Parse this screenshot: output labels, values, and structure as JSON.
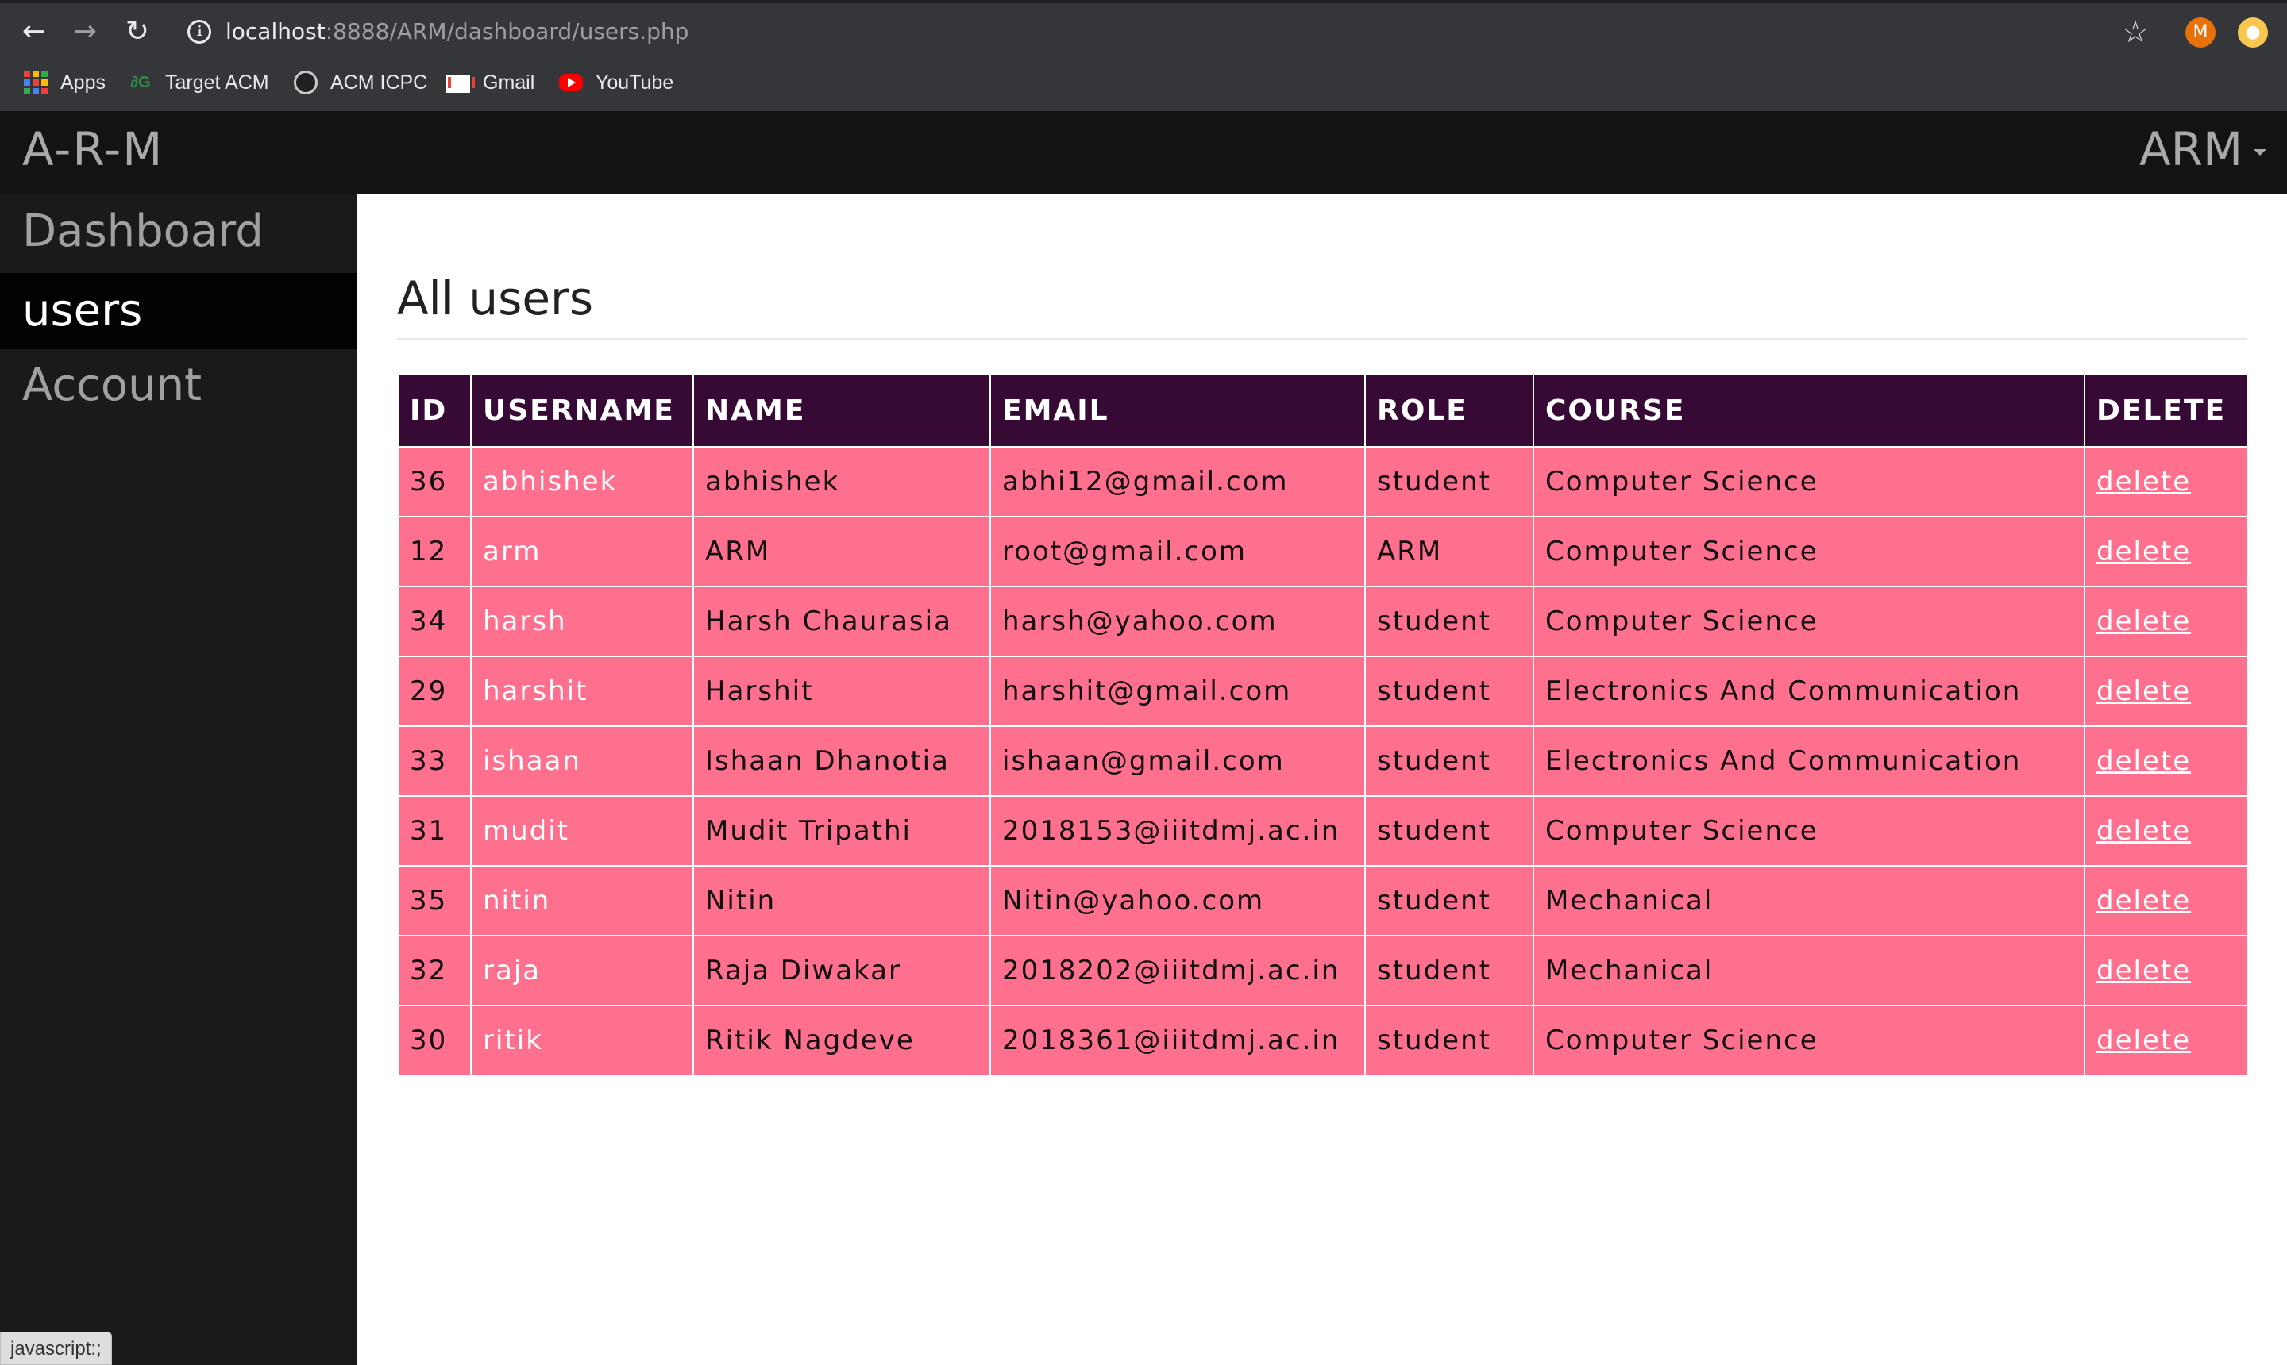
{
  "browser": {
    "url_host": "localhost",
    "url_rest": ":8888/ARM/dashboard/users.php",
    "avatar_letter": "M",
    "bookmarks": [
      {
        "label": "Apps",
        "icon": "apps-grid-icon"
      },
      {
        "label": "Target ACM",
        "icon": "geeksforgeeks-icon"
      },
      {
        "label": "ACM ICPC",
        "icon": "github-icon"
      },
      {
        "label": "Gmail",
        "icon": "gmail-icon"
      },
      {
        "label": "YouTube",
        "icon": "youtube-icon"
      }
    ]
  },
  "header": {
    "brand": "A-R-M",
    "user_menu": "ARM"
  },
  "sidebar": {
    "items": [
      {
        "label": "Dashboard",
        "active": false
      },
      {
        "label": "users",
        "active": true
      },
      {
        "label": "Account",
        "active": false
      }
    ]
  },
  "status_bar": "javascript:;",
  "main": {
    "title": "All users",
    "table": {
      "columns": [
        "ID",
        "USERNAME",
        "NAME",
        "EMAIL",
        "ROLE",
        "COURSE",
        "DELETE"
      ],
      "rows": [
        {
          "id": "36",
          "username": "abhishek",
          "name": "abhishek",
          "email": "abhi12@gmail.com",
          "role": "student",
          "course": "Computer Science",
          "action": "delete"
        },
        {
          "id": "12",
          "username": "arm",
          "name": "ARM",
          "email": "root@gmail.com",
          "role": "ARM",
          "course": "Computer Science",
          "action": "delete"
        },
        {
          "id": "34",
          "username": "harsh",
          "name": "Harsh Chaurasia",
          "email": "harsh@yahoo.com",
          "role": "student",
          "course": "Computer Science",
          "action": "delete"
        },
        {
          "id": "29",
          "username": "harshit",
          "name": "Harshit",
          "email": "harshit@gmail.com",
          "role": "student",
          "course": "Electronics And Communication",
          "action": "delete"
        },
        {
          "id": "33",
          "username": "ishaan",
          "name": "Ishaan Dhanotia",
          "email": "ishaan@gmail.com",
          "role": "student",
          "course": "Electronics And Communication",
          "action": "delete"
        },
        {
          "id": "31",
          "username": "mudit",
          "name": "Mudit Tripathi",
          "email": "2018153@iiitdmj.ac.in",
          "role": "student",
          "course": "Computer Science",
          "action": "delete"
        },
        {
          "id": "35",
          "username": "nitin",
          "name": "Nitin",
          "email": "Nitin@yahoo.com",
          "role": "student",
          "course": "Mechanical",
          "action": "delete"
        },
        {
          "id": "32",
          "username": "raja",
          "name": "Raja Diwakar",
          "email": "2018202@iiitdmj.ac.in",
          "role": "student",
          "course": "Mechanical",
          "action": "delete"
        },
        {
          "id": "30",
          "username": "ritik",
          "name": "Ritik Nagdeve",
          "email": "2018361@iiitdmj.ac.in",
          "role": "student",
          "course": "Computer Science",
          "action": "delete"
        }
      ]
    }
  },
  "colors": {
    "header_bg": "#131313",
    "sidebar_bg": "#1a1a1a",
    "sidebar_active_bg": "#020202",
    "table_head_bg": "#360a34",
    "table_row_bg": "#ff6f8e"
  }
}
